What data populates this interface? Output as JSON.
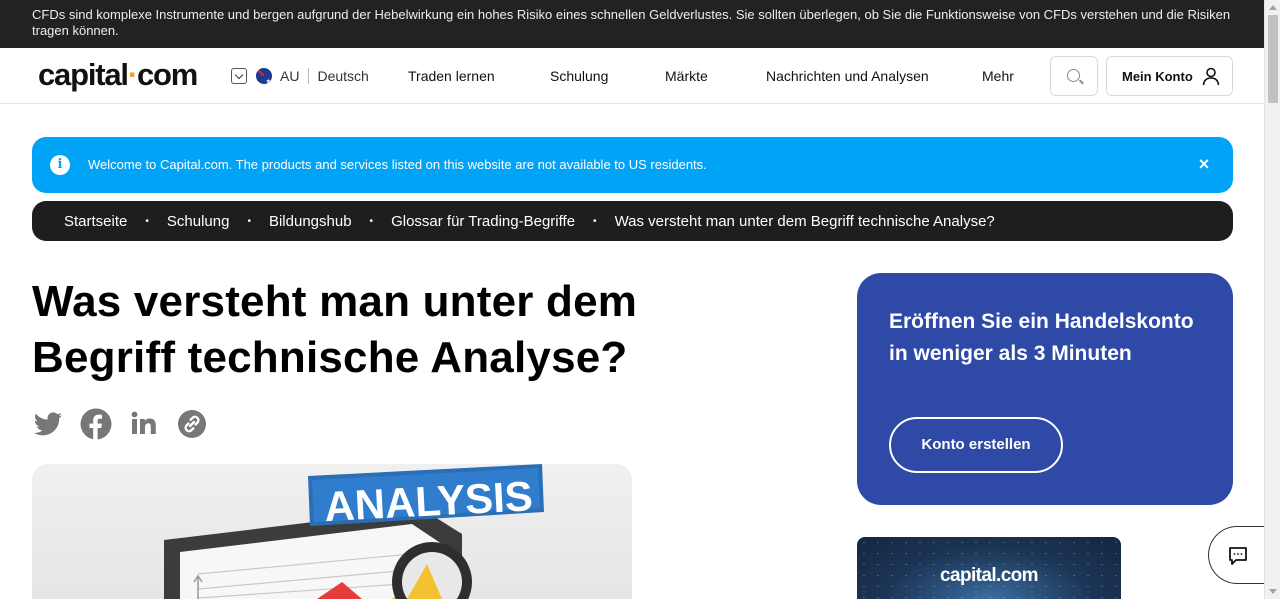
{
  "risk_warning": "CFDs sind komplexe Instrumente und bergen aufgrund der Hebelwirkung ein hohes Risiko eines schnellen Geldverlustes. Sie sollten überlegen, ob Sie die Funktionsweise von CFDs verstehen und die Risiken tragen können.",
  "header": {
    "logo_left": "capital",
    "logo_dot": "·",
    "logo_right": "com",
    "region_code": "AU",
    "language": "Deutsch",
    "nav": [
      "Traden lernen",
      "Schulung",
      "Märkte",
      "Nachrichten und Analysen",
      "Mehr"
    ],
    "account_label": "Mein Konto"
  },
  "info_banner": {
    "icon": "i",
    "text": "Welcome to Capital.com. The products and services listed on this website are not available to US residents.",
    "close": "×"
  },
  "breadcrumb": [
    "Startseite",
    "Schulung",
    "Bildungshub",
    "Glossar für Trading-Begriffe",
    "Was versteht man unter dem Begriff technische Analyse?"
  ],
  "breadcrumb_separator": "•",
  "article": {
    "title_line1": "Was versteht man unter dem",
    "title_line2": "Begriff technische Analyse?",
    "share_icons": [
      "twitter-icon",
      "facebook-icon",
      "linkedin-icon",
      "link-icon"
    ],
    "hero_sign_text": "ANALYSIS"
  },
  "cta": {
    "text": "Eröffnen Sie ein Handelskonto in weniger als 3 Minuten",
    "button": "Konto erstellen"
  },
  "promo": {
    "logo": "capital.com"
  },
  "colors": {
    "risk_bar": "#222222",
    "info_banner": "#00a3f5",
    "breadcrumb": "#1e1e1e",
    "cta_card": "#2e4aa6",
    "logo_dot": "#f59e36"
  }
}
